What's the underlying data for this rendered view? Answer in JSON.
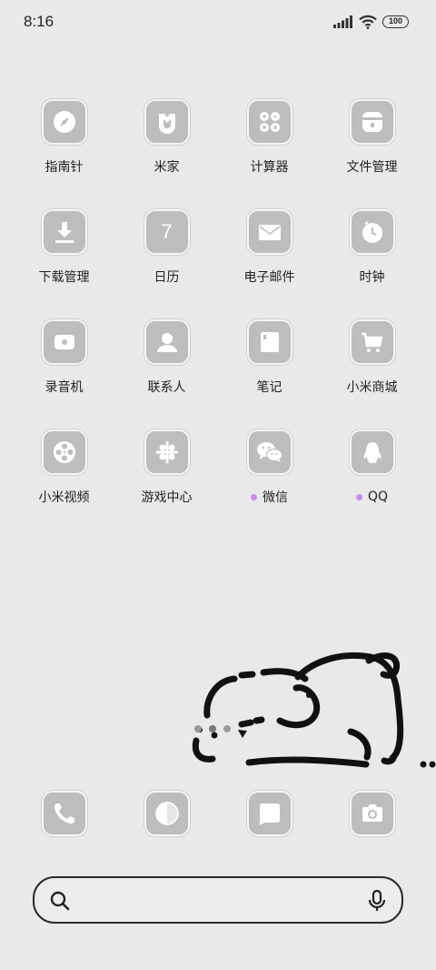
{
  "status_bar": {
    "time": "8:16",
    "battery": "100",
    "icons": [
      "signal-icon",
      "wifi-icon",
      "battery-icon"
    ]
  },
  "apps": [
    {
      "label": "指南针",
      "icon": "compass-icon",
      "badge": false
    },
    {
      "label": "米家",
      "icon": "mijia-icon",
      "badge": false
    },
    {
      "label": "计算器",
      "icon": "calculator-icon",
      "badge": false
    },
    {
      "label": "文件管理",
      "icon": "file-manager-icon",
      "badge": false
    },
    {
      "label": "下载管理",
      "icon": "download-icon",
      "badge": false
    },
    {
      "label": "日历",
      "icon": "calendar-icon",
      "badge": false,
      "icon_text": "7"
    },
    {
      "label": "电子邮件",
      "icon": "email-icon",
      "badge": false
    },
    {
      "label": "时钟",
      "icon": "clock-icon",
      "badge": false
    },
    {
      "label": "录音机",
      "icon": "recorder-icon",
      "badge": false
    },
    {
      "label": "联系人",
      "icon": "contacts-icon",
      "badge": false
    },
    {
      "label": "笔记",
      "icon": "notes-icon",
      "badge": false
    },
    {
      "label": "小米商城",
      "icon": "shop-cart-icon",
      "badge": false
    },
    {
      "label": "小米视频",
      "icon": "video-reel-icon",
      "badge": false
    },
    {
      "label": "游戏中心",
      "icon": "game-center-icon",
      "badge": false
    },
    {
      "label": "微信",
      "icon": "wechat-icon",
      "badge": true
    },
    {
      "label": "QQ",
      "icon": "qq-penguin-icon",
      "badge": true
    }
  ],
  "dock": [
    {
      "icon": "phone-icon"
    },
    {
      "icon": "browser-icon"
    },
    {
      "icon": "messages-icon"
    },
    {
      "icon": "camera-icon"
    }
  ],
  "page_indicator": {
    "pages": 3,
    "current": 1
  },
  "colors": {
    "background": "#e9e9e9",
    "icon_fill": "#bdbdbd",
    "badge_dot": "#c98af0"
  }
}
